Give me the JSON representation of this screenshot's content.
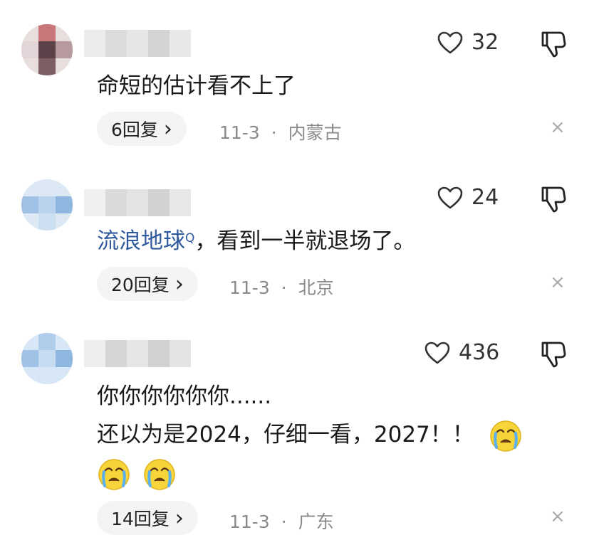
{
  "comments": [
    {
      "likes": "32",
      "text": "命短的估计看不上了",
      "replies": "6回复",
      "date": "11-3",
      "location": "内蒙古"
    },
    {
      "likes": "24",
      "link": "流浪地球",
      "search_mark": "Q",
      "text": "，看到一半就退场了。",
      "replies": "20回复",
      "date": "11-3",
      "location": "北京"
    },
    {
      "likes": "436",
      "line1": "你你你你你你......",
      "line2": "还以为是2024，仔细一看，2027！！",
      "replies": "14回复",
      "date": "11-3",
      "location": "广东"
    }
  ],
  "separator": "·",
  "chevron": "›",
  "close": "×",
  "icons": {
    "heart": "heart-outline-icon",
    "thumb": "thumbs-down-icon",
    "emoji": "crying-emoji-icon"
  },
  "colors": {
    "link": "#2f5a9e",
    "meta": "#8a8a8a",
    "pill_bg": "#f4f4f4"
  }
}
